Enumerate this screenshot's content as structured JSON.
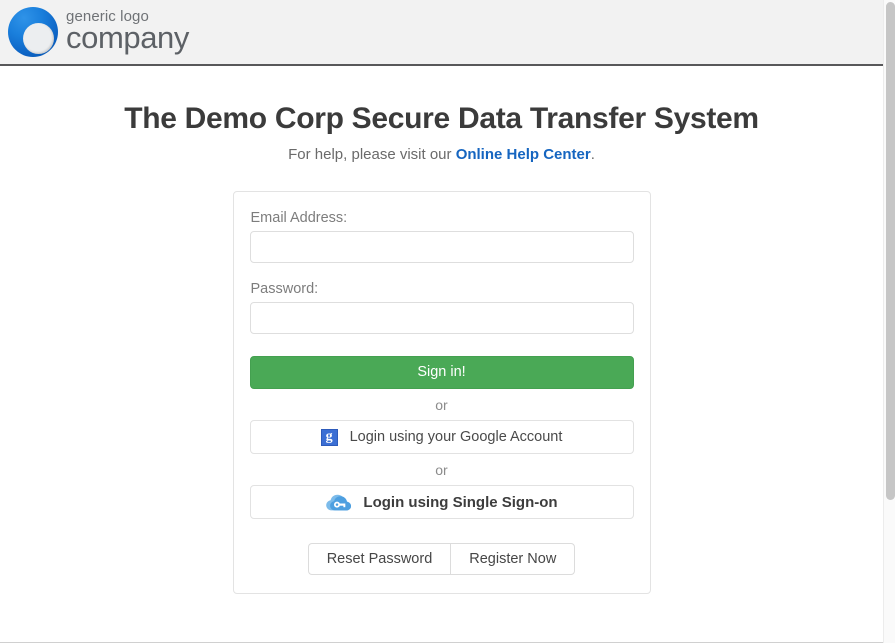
{
  "header": {
    "logo_icon": "generic-company-logo-circle",
    "brand_line1": "generic logo",
    "brand_line2": "company"
  },
  "main": {
    "title": "The Demo Corp Secure Data Transfer System",
    "subtitle_prefix": "For help, please visit our ",
    "subtitle_link": "Online Help Center",
    "subtitle_suffix": "."
  },
  "login_form": {
    "email_label": "Email Address:",
    "email_value": "",
    "email_placeholder": "",
    "password_label": "Password:",
    "password_value": "",
    "password_placeholder": "",
    "signin_label": "Sign in!",
    "or_label_1": "or",
    "google_icon": "google-g-icon",
    "google_label": "Login using your Google Account",
    "or_label_2": "or",
    "sso_icon": "cloud-key-icon",
    "sso_label": "Login using Single Sign-on",
    "reset_password_label": "Reset Password",
    "register_now_label": "Register Now"
  },
  "colors": {
    "signin_green": "#4aa956",
    "link_blue": "#1565c0",
    "logo_blue": "#1a7fdc",
    "google_blue": "#3b6fd4",
    "sso_cloud_blue": "#6cb3e8",
    "header_bg": "#f2f2f2",
    "header_rule": "#58585a"
  },
  "scrollbar": {
    "thumb_position": "top"
  }
}
